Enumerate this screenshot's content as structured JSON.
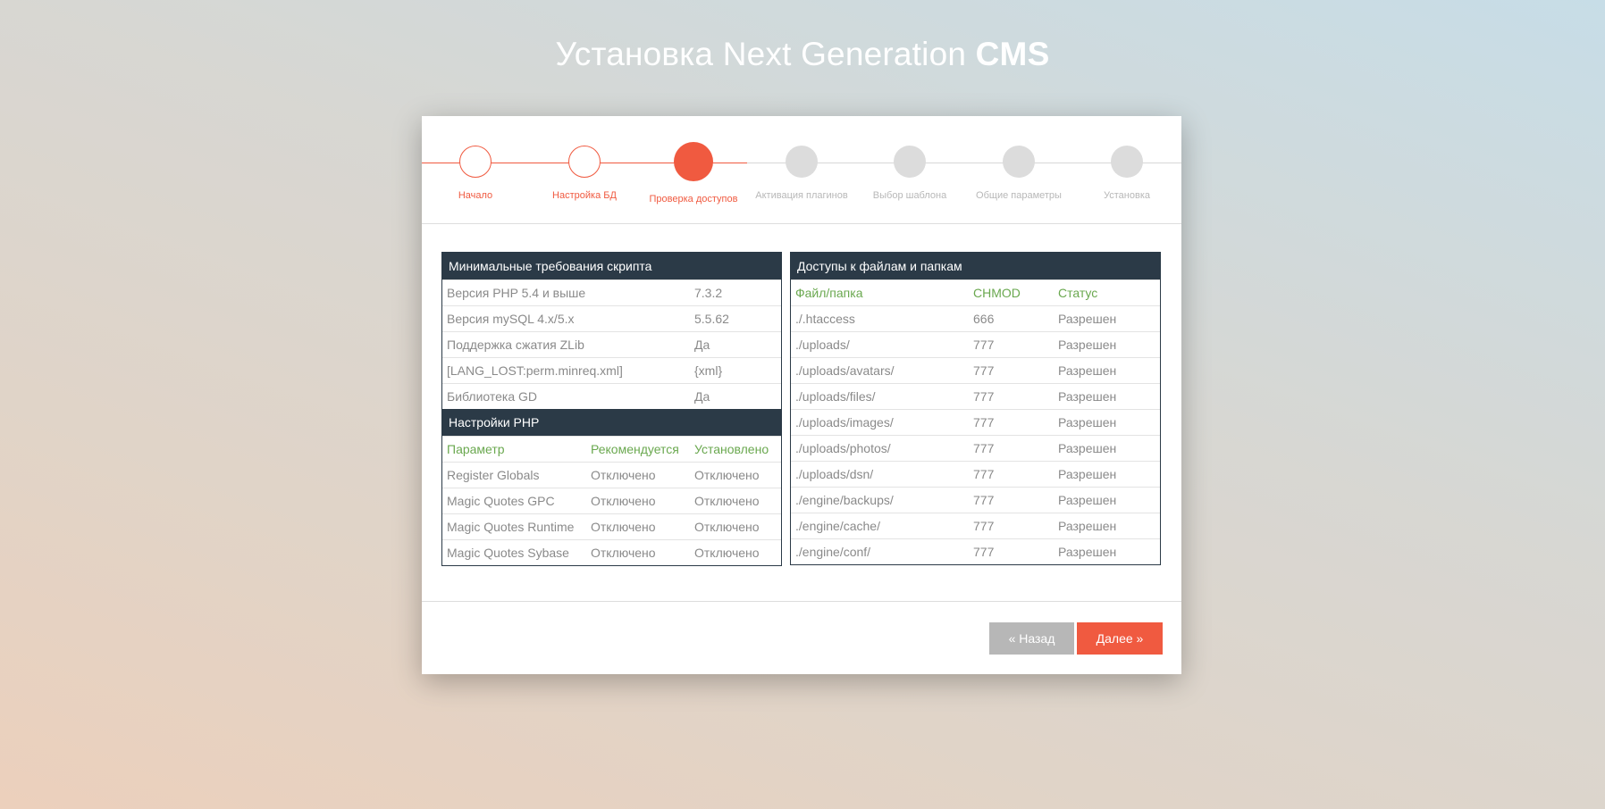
{
  "title": {
    "part1": "Установка ",
    "n_letter": "N",
    "part2": "ext ",
    "g_letter": "G",
    "part3": "eneration ",
    "cms": "CMS"
  },
  "steps": [
    {
      "label": "Начало",
      "state": "done"
    },
    {
      "label": "Настройка БД",
      "state": "done"
    },
    {
      "label": "Проверка доступов",
      "state": "active"
    },
    {
      "label": "Активация плагинов",
      "state": "pending"
    },
    {
      "label": "Выбор шаблона",
      "state": "pending"
    },
    {
      "label": "Общие параметры",
      "state": "pending"
    },
    {
      "label": "Установка",
      "state": "pending"
    }
  ],
  "requirements": {
    "heading": "Минимальные требования скрипта",
    "rows": [
      {
        "name": "Версия PHP 5.4 и выше",
        "value": "7.3.2"
      },
      {
        "name": "Версия mySQL 4.x/5.x",
        "value": "5.5.62"
      },
      {
        "name": "Поддержка сжатия ZLib",
        "value": "Да"
      },
      {
        "name": "[LANG_LOST:perm.minreq.xml]",
        "value": "{xml}"
      },
      {
        "name": "Библиотека GD",
        "value": "Да"
      }
    ]
  },
  "php_settings": {
    "heading": "Настройки PHP",
    "columns": [
      "Параметр",
      "Рекомендуется",
      "Установлено"
    ],
    "rows": [
      [
        "Register Globals",
        "Отключено",
        "Отключено"
      ],
      [
        "Magic Quotes GPC",
        "Отключено",
        "Отключено"
      ],
      [
        "Magic Quotes Runtime",
        "Отключено",
        "Отключено"
      ],
      [
        "Magic Quotes Sybase",
        "Отключено",
        "Отключено"
      ]
    ]
  },
  "permissions": {
    "heading": "Доступы к файлам и папкам",
    "columns": [
      "Файл/папка",
      "CHMOD",
      "Статус"
    ],
    "rows": [
      [
        "./.htaccess",
        "666",
        "Разрешен"
      ],
      [
        "./uploads/",
        "777",
        "Разрешен"
      ],
      [
        "./uploads/avatars/",
        "777",
        "Разрешен"
      ],
      [
        "./uploads/files/",
        "777",
        "Разрешен"
      ],
      [
        "./uploads/images/",
        "777",
        "Разрешен"
      ],
      [
        "./uploads/photos/",
        "777",
        "Разрешен"
      ],
      [
        "./uploads/dsn/",
        "777",
        "Разрешен"
      ],
      [
        "./engine/backups/",
        "777",
        "Разрешен"
      ],
      [
        "./engine/cache/",
        "777",
        "Разрешен"
      ],
      [
        "./engine/conf/",
        "777",
        "Разрешен"
      ]
    ]
  },
  "buttons": {
    "back": "« Назад",
    "next": "Далее »"
  },
  "colors": {
    "accent": "#f05a40",
    "header_dark": "#2b3a47",
    "column_green": "#6aa84f",
    "pending_gray": "#dcdcdc"
  }
}
